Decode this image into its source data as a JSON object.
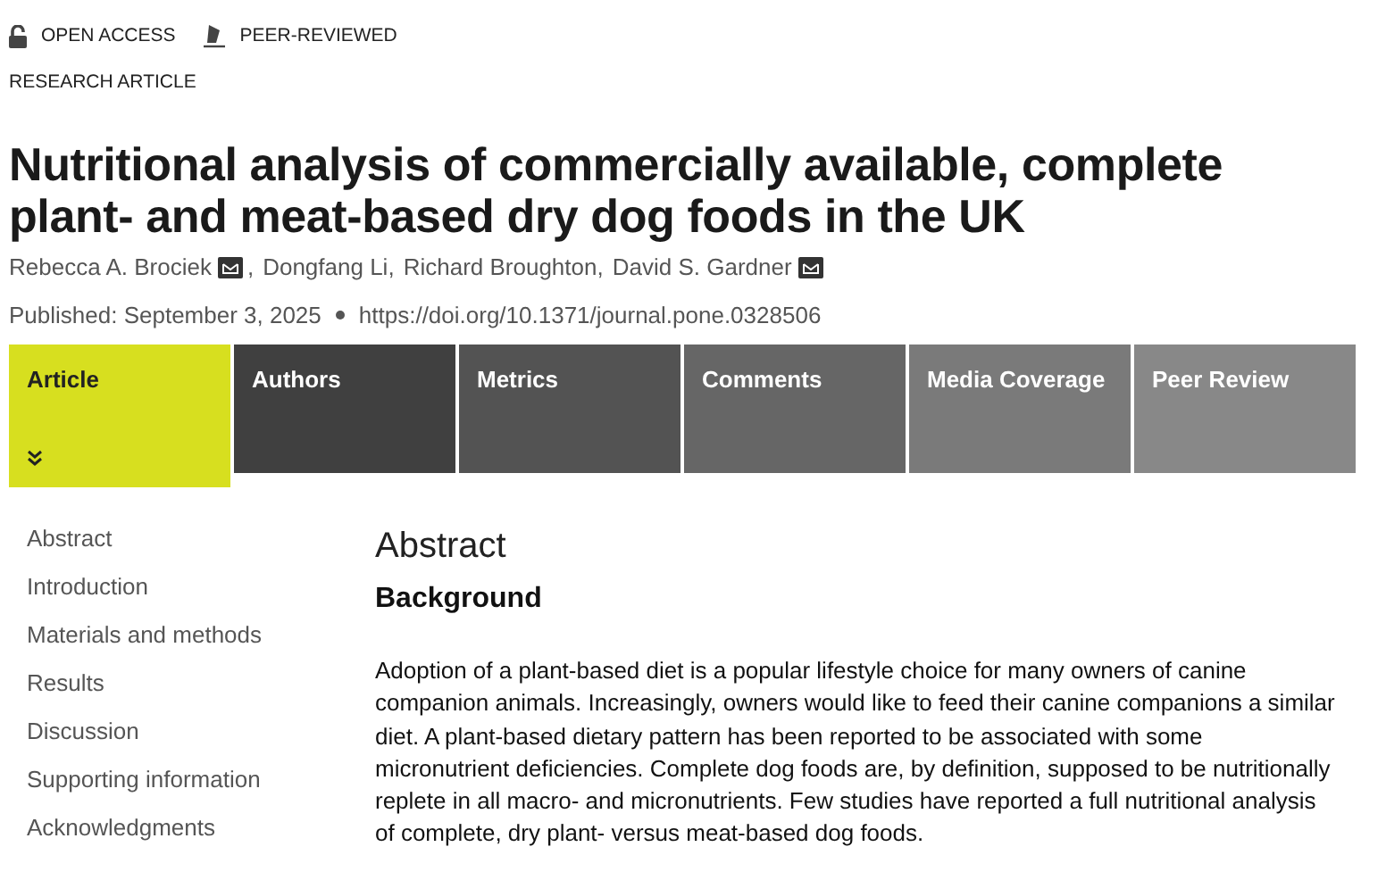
{
  "badges": [
    {
      "kind": "lock",
      "label": "OPEN ACCESS"
    },
    {
      "kind": "pen",
      "label": "PEER-REVIEWED"
    }
  ],
  "article_type": "RESEARCH ARTICLE",
  "title": "Nutritional analysis of commercially available, complete plant- and meat-based dry dog foods in the UK",
  "authors": [
    {
      "name": "Rebecca A. Brociek",
      "email": true,
      "separator": ","
    },
    {
      "name": "Dongfang Li",
      "email": false,
      "separator": ","
    },
    {
      "name": "Richard Broughton",
      "email": false,
      "separator": ","
    },
    {
      "name": "David S. Gardner",
      "email": true
    }
  ],
  "published": "Published: September 3, 2025",
  "doi": "https://doi.org/10.1371/journal.pone.0328506",
  "tabs": [
    {
      "label": "Article",
      "selected": true
    },
    {
      "label": "Authors",
      "selected": false
    },
    {
      "label": "Metrics",
      "selected": false
    },
    {
      "label": "Comments",
      "selected": false
    },
    {
      "label": "Media Coverage",
      "selected": false
    },
    {
      "label": "Peer Review",
      "selected": false
    }
  ],
  "sidebar": {
    "items": [
      "Abstract",
      "Introduction",
      "Materials and methods",
      "Results",
      "Discussion",
      "Supporting information",
      "Acknowledgments"
    ]
  },
  "content": {
    "heading": "Abstract",
    "subheading": "Background",
    "paragraph": "Adoption of a plant-based diet is a popular lifestyle choice for many owners of canine companion animals. Increasingly, owners would like to feed their canine companions a similar diet. A plant-based dietary pattern has been reported to be associated with some micronutrient deficiencies. Complete dog foods are, by definition, supposed to be nutritionally replete in all macro- and micronutrients. Few studies have reported a full nutritional analysis of complete, dry plant- versus meat-based dog foods."
  }
}
